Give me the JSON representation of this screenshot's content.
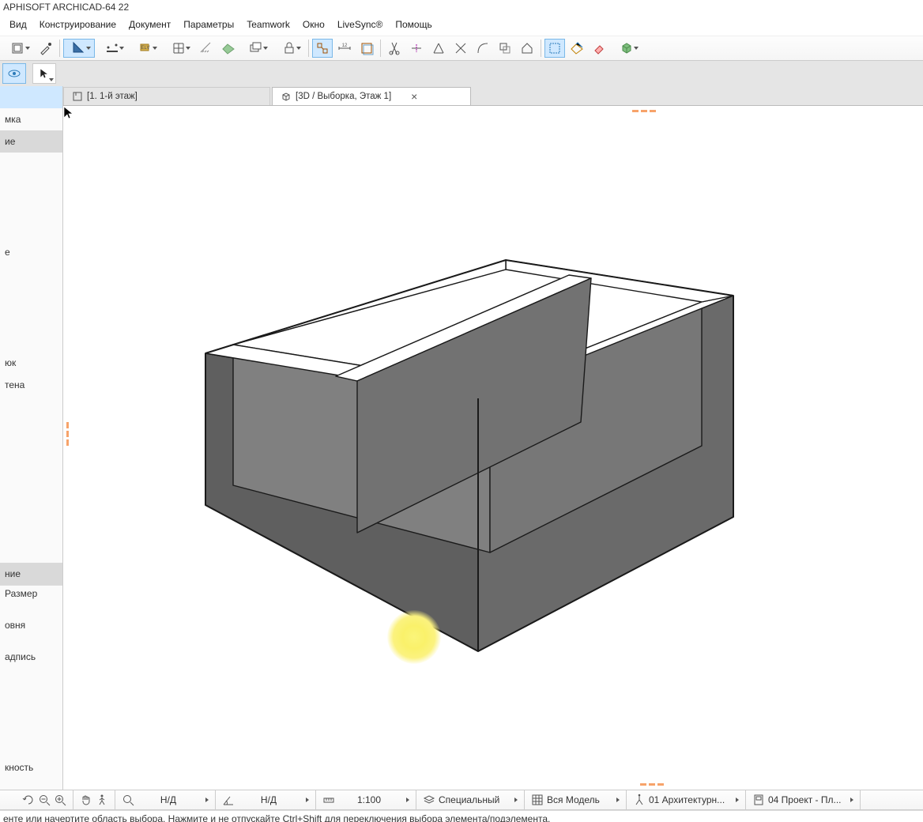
{
  "app_title": "APHISOFT ARCHICAD-64 22",
  "menu": [
    "Вид",
    "Конструирование",
    "Документ",
    "Параметры",
    "Teamwork",
    "Окно",
    "LiveSync®",
    "Помощь"
  ],
  "menu_underline_index": [
    -1,
    -1,
    0,
    -1,
    -1,
    -1,
    -1,
    -1
  ],
  "tabs": [
    {
      "label": "[1. 1-й этаж]",
      "icon": "floorplan-icon"
    },
    {
      "label": "[3D / Выборка, Этаж 1]",
      "icon": "cube-icon",
      "current": true,
      "closable": true
    }
  ],
  "sidebar": {
    "top_items": [
      {
        "label": "",
        "active": true
      },
      {
        "label": "мка"
      },
      {
        "label": "ие",
        "header": true
      },
      {
        "label": " "
      },
      {
        "label": " "
      },
      {
        "label": " "
      },
      {
        "label": " "
      },
      {
        "label": "е"
      },
      {
        "label": " "
      },
      {
        "label": " "
      },
      {
        "label": " "
      },
      {
        "label": " "
      },
      {
        "label": "юк"
      },
      {
        "label": "тена"
      }
    ],
    "section_header": "ние",
    "list_items": [
      "Размер",
      "",
      "овня",
      "",
      "адпись",
      "",
      "",
      "",
      "",
      "",
      "",
      "кность",
      ""
    ]
  },
  "status": {
    "value1": "Н/Д",
    "value2": "Н/Д",
    "scale": "1:100",
    "layer_combo": "Специальный",
    "model_view": "Вся Модель",
    "reno_filter": "01 Архитектурн...",
    "layout": "04 Проект - Пл..."
  },
  "hint": "енте или начертите область выбора. Нажмите и не отпускайте Ctrl+Shift для переключения выбора элемента/подэлемента."
}
